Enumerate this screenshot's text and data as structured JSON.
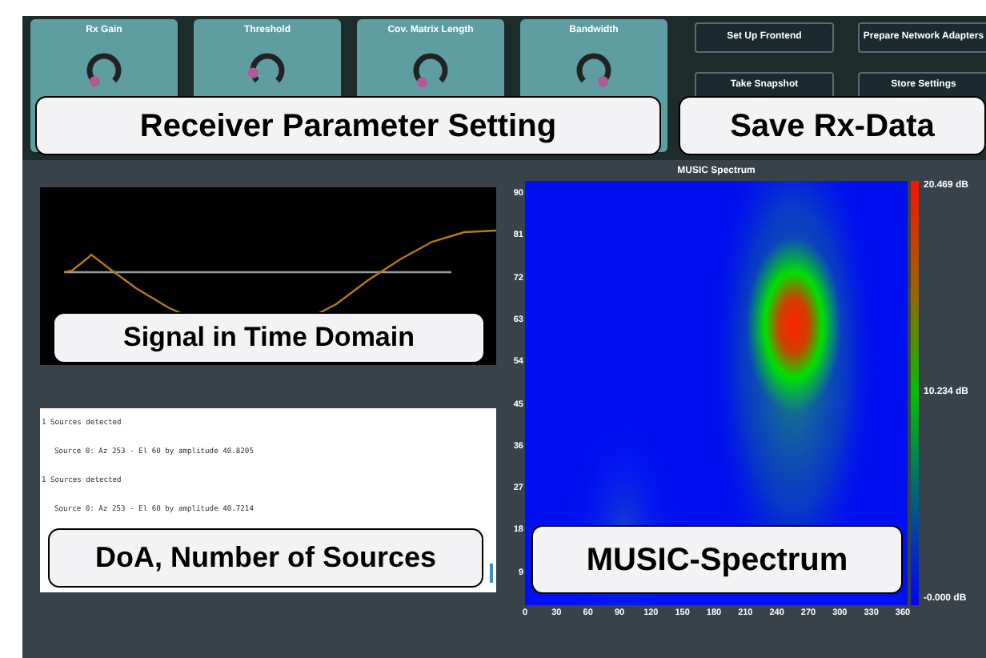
{
  "receiver_panel": {
    "knobs": [
      {
        "label": "Rx Gain"
      },
      {
        "label": "Threshold"
      },
      {
        "label": "Cov. Matrix Length"
      },
      {
        "label": "Bandwidth"
      }
    ],
    "annotation": "Receiver Parameter Setting"
  },
  "rx_data_panel": {
    "buttons": [
      "Set Up Frontend",
      "Prepare Network Adapters",
      "Take Snapshot",
      "Store Settings"
    ],
    "annotation": "Save Rx-Data"
  },
  "time_signal": {
    "annotation": "Signal in Time Domain"
  },
  "doa_log": {
    "lines": [
      "1 Sources detected",
      "Source 0: Az 253 - El 60 by amplitude 40.8205",
      "1 Sources detected",
      "Source 0: Az 253 - El 60 by amplitude 40.7214"
    ],
    "annotation": "DoA, Number of Sources"
  },
  "music_spectrum": {
    "title": "MUSIC Spectrum",
    "y_ticks": [
      "90",
      "81",
      "72",
      "63",
      "54",
      "45",
      "36",
      "27",
      "18",
      "9"
    ],
    "x_ticks": [
      "0",
      "30",
      "60",
      "90",
      "120",
      "150",
      "180",
      "210",
      "240",
      "270",
      "300",
      "330",
      "360"
    ],
    "colorbar_labels": [
      "20.469 dB",
      "10.234 dB",
      "-0.000 dB"
    ],
    "annotation": "MUSIC-Spectrum"
  }
}
